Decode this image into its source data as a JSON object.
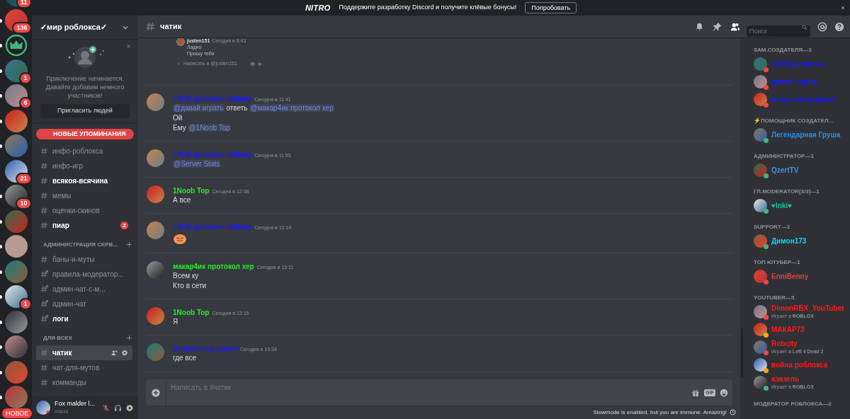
{
  "nitro_bar": {
    "logo": "NITRO",
    "text": "Поддержите разработку Discord и получите клёвые бонусы!",
    "button": "Попробовать"
  },
  "servers": [
    {
      "badge": "11",
      "unread": false
    },
    {
      "badge": "136",
      "unread": true
    },
    {
      "kind": "crown",
      "unread": true
    },
    {
      "badge": "1",
      "unread": true
    },
    {
      "badge": "6",
      "unread": true
    },
    {
      "unread": true
    },
    {
      "unread": true
    },
    {
      "badge": "21",
      "unread": false
    },
    {
      "badge": "10",
      "unread": true
    },
    {
      "unread": true
    },
    {
      "unread": true
    },
    {
      "unread": true
    },
    {
      "badge": "1",
      "unread": true
    },
    {
      "unread": true
    },
    {
      "unread": true
    },
    {
      "unread": true
    },
    {
      "unread": true
    }
  ],
  "new_badge": "НОВОЕ",
  "server_name": "✓мир роблокса✓",
  "invite_card": {
    "text": "Приключение начинается. Давайте добавим немного участников!",
    "button": "Пригласить людей"
  },
  "new_mentions": "НОВЫЕ УПОМИНАНИЯ",
  "channels": [
    {
      "kind": "channel",
      "name": "инфо-роблокса",
      "unread": false,
      "selected": false,
      "locked": false
    },
    {
      "kind": "channel",
      "name": "инфо-игр",
      "unread": false,
      "selected": false,
      "locked": false
    },
    {
      "kind": "channel",
      "name": "всякоя-всячина",
      "unread": true,
      "selected": false,
      "locked": false
    },
    {
      "kind": "channel",
      "name": "мемы",
      "unread": false,
      "selected": false,
      "locked": false
    },
    {
      "kind": "channel",
      "name": "оценки-скинов",
      "unread": false,
      "selected": false,
      "locked": false
    },
    {
      "kind": "channel",
      "name": "пиар",
      "unread": true,
      "selected": false,
      "locked": false,
      "badge": "2"
    },
    {
      "kind": "category",
      "name": "АДМИНИСТРАЦИЯ СЕРВ..."
    },
    {
      "kind": "channel",
      "name": "баны-и-муты",
      "unread": false,
      "selected": false,
      "locked": false
    },
    {
      "kind": "channel",
      "name": "правила-модератор...",
      "unread": false,
      "selected": false,
      "locked": true
    },
    {
      "kind": "channel",
      "name": "админ-чат-с-м...",
      "unread": false,
      "selected": false,
      "locked": true
    },
    {
      "kind": "channel",
      "name": "админ-чат",
      "unread": false,
      "selected": false,
      "locked": true
    },
    {
      "kind": "channel",
      "name": "логи",
      "unread": true,
      "selected": false,
      "locked": true
    },
    {
      "kind": "category",
      "name": "ДЛЯ ВСЕХ"
    },
    {
      "kind": "channel",
      "name": "чатик",
      "unread": false,
      "selected": true,
      "locked": false
    },
    {
      "kind": "channel",
      "name": "чат-для-мутов",
      "unread": false,
      "selected": false,
      "locked": false
    },
    {
      "kind": "channel",
      "name": "комманды",
      "unread": false,
      "selected": false,
      "locked": false
    }
  ],
  "user": {
    "name": "Fox malder l...",
    "tag": "#4848",
    "muted": true
  },
  "channel_header": {
    "name": "чатик"
  },
  "search": {
    "placeholder": "Поиск"
  },
  "embedded_screenshot": {
    "author": "justen151",
    "time": "Сегодня в 8:43",
    "lines": [
      "Ладно",
      "Прошу тебя"
    ],
    "placeholder": "Написать в @justen151"
  },
  "messages": [
    {
      "author": "! 4CB детектив пиКачу",
      "color": "#1a1aff",
      "time": "Сегодня в 11:41",
      "lines": [
        [
          {
            "text": "@давай играть",
            "mention": true
          },
          {
            "text": " ответь ",
            "mention": false
          },
          {
            "text": "@макар4ик протокол хер",
            "mention": true
          }
        ],
        [
          {
            "text": "Ой",
            "mention": false
          }
        ],
        [
          {
            "text": "Ему ",
            "mention": false
          },
          {
            "text": "@1Noob Top",
            "mention": true
          }
        ]
      ]
    },
    {
      "author": "! 4CB детектив пиКачу",
      "color": "#1a1aff",
      "time": "Сегодня в 11:55",
      "lines": [
        [
          {
            "text": "@Server Stats",
            "mention": true
          }
        ]
      ]
    },
    {
      "author": "1Noob Top",
      "color": "#2ee62e",
      "time": "Сегодня в 12:08",
      "lines": [
        [
          {
            "text": "А все",
            "mention": false
          }
        ]
      ]
    },
    {
      "author": "! 4CB детектив пиКачу",
      "color": "#1a1aff",
      "time": "Сегодня в 12:14",
      "emoji": true
    },
    {
      "author": "макар4ик протокол хер",
      "color": "#2ee62e",
      "time": "Сегодня в 13:11",
      "lines": [
        [
          {
            "text": "Всем ку",
            "mention": false
          }
        ],
        [
          {
            "text": "Кто в сети",
            "mention": false
          }
        ]
      ]
    },
    {
      "author": "1Noob Top",
      "color": "#2ee62e",
      "time": "Сегодня в 13:15",
      "lines": [
        [
          {
            "text": "Я",
            "mention": false
          }
        ]
      ]
    },
    {
      "author": "метропоезд рисуч",
      "color": "#1a1aff",
      "time": "Сегодня в 13:34",
      "lines": [
        [
          {
            "text": "где все",
            "mention": false
          }
        ]
      ]
    }
  ],
  "composer": {
    "placeholder": "Написать в #чатик",
    "gif": "GIF"
  },
  "slowmode": "Slowmode is enabled, but you are immune. Amazing!",
  "member_groups": [
    {
      "title": "ЗАМ.СОЗДАТЕЛЯ—3",
      "color": "#1a1aff",
      "members": [
        {
          "name": "! 4CB детектив",
          "color": "#f04747"
        },
        {
          "name": "давай играть",
          "color": "#f04747"
        },
        {
          "name": "метропоезд рисуч",
          "color": "#f04747"
        }
      ]
    },
    {
      "title": "⚡ПОМОЩНИК СОЗДАТЕЛ...",
      "color": "#2f8fe8",
      "members": [
        {
          "name": "Легендарная Груша",
          "color": "#43b581"
        }
      ]
    },
    {
      "title": "АДМИНИСТРАТОР—1",
      "color": "#3498db",
      "members": [
        {
          "name": "QzertTV",
          "color": "#43b581"
        }
      ]
    },
    {
      "title": "ГЛ.MODERATOR[3/3]—1",
      "color": "#1abc9c",
      "members": [
        {
          "name": "♥Inki♥",
          "color": "#43b581"
        }
      ]
    },
    {
      "title": "SUPPORT—1",
      "color": "#16d4f0",
      "members": [
        {
          "name": "Димон173",
          "color": "#43b581"
        }
      ]
    },
    {
      "title": "ТОП ЮТУБЕР—1",
      "color": "#d9413a",
      "members": [
        {
          "name": "EnniBenny",
          "color": "#f04747"
        }
      ]
    },
    {
      "title": "YOUTUBER—5",
      "color": "#ff1a1a",
      "members": [
        {
          "name": "DimonRBX_YouTuber",
          "color": "#f04747",
          "activity": "Играет в **ROBLOX**"
        },
        {
          "name": "МАКАР73",
          "color": "#faa61a"
        },
        {
          "name": "Robcity",
          "color": "#f04747",
          "activity": "Играет в **Left 4 Dead 2**"
        },
        {
          "name": "война роблокса",
          "color": "#faa61a"
        },
        {
          "name": "азазель",
          "color": "#43b581",
          "activity": "Играет в **ROBLOX**"
        }
      ]
    },
    {
      "title": "МОДЕРАТОР РОБЛОКСА—2"
    }
  ]
}
